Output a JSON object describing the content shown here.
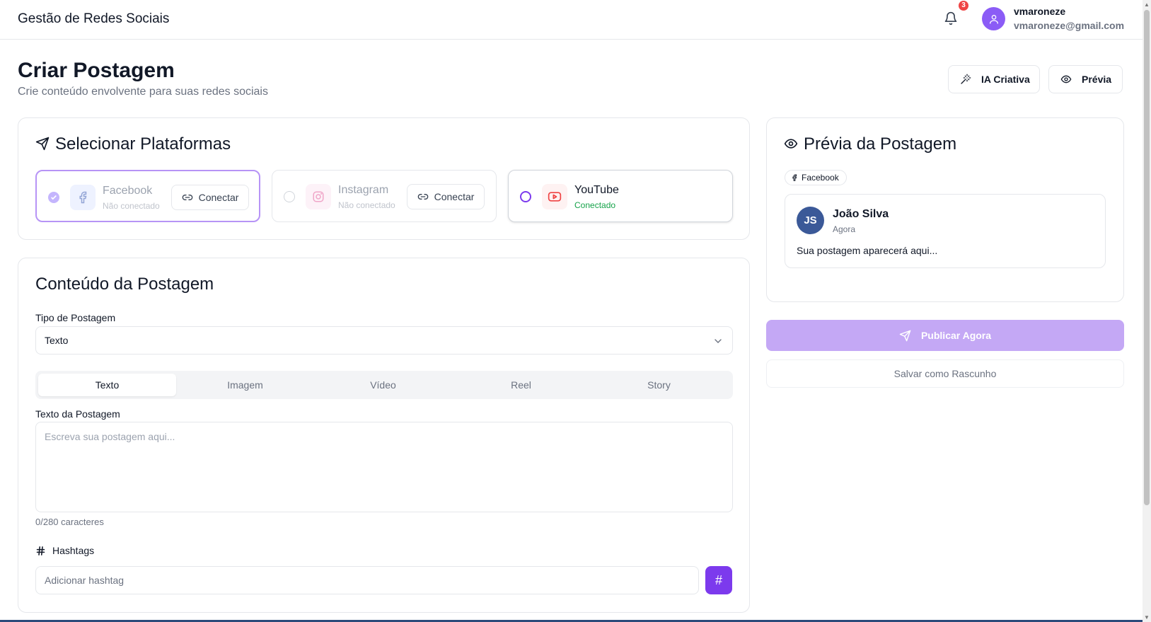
{
  "header": {
    "app_title": "Gestão de Redes Sociais",
    "notification_count": "3",
    "user_name": "vmaroneze",
    "user_email": "vmaroneze@gmail.com"
  },
  "page": {
    "title": "Criar Postagem",
    "subtitle": "Crie conteúdo envolvente para suas redes sociais",
    "ai_button": "IA Criativa",
    "preview_button": "Prévia"
  },
  "platforms": {
    "title": "Selecionar Plataformas",
    "items": [
      {
        "name": "Facebook",
        "status": "Não conectado",
        "action": "Conectar",
        "icon": "facebook-icon",
        "color": "#1877f2"
      },
      {
        "name": "Instagram",
        "status": "Não conectado",
        "action": "Conectar",
        "icon": "instagram-icon",
        "color": "#e1306c"
      },
      {
        "name": "YouTube",
        "status": "Conectado",
        "icon": "youtube-icon",
        "color": "#ef4444"
      }
    ]
  },
  "content": {
    "title": "Conteúdo da Postagem",
    "type_label": "Tipo de Postagem",
    "type_value": "Texto",
    "tabs": [
      "Texto",
      "Imagem",
      "Vídeo",
      "Reel",
      "Story"
    ],
    "text_label": "Texto da Postagem",
    "text_placeholder": "Escreva sua postagem aqui...",
    "counter": "0/280 caracteres",
    "hashtags_label": "Hashtags",
    "hashtag_placeholder": "Adicionar hashtag",
    "hashtag_button": "#"
  },
  "preview": {
    "title": "Prévia da Postagem",
    "platform_chip": "Facebook",
    "avatar_initials": "JS",
    "author": "João Silva",
    "time": "Agora",
    "text": "Sua postagem aparecerá aqui..."
  },
  "actions": {
    "publish": "Publicar Agora",
    "draft": "Salvar como Rascunho"
  },
  "colors": {
    "accent": "#7c3aed",
    "accent_light": "#c4a8f5",
    "connected_text": "#16a34a"
  }
}
